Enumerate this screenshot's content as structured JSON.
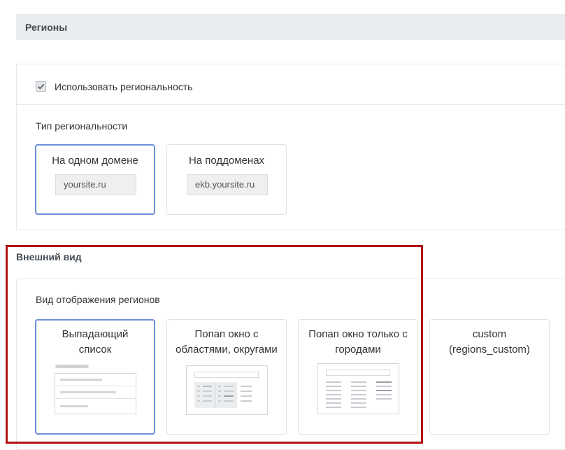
{
  "regions": {
    "header": "Регионы",
    "use_regionality": {
      "label": "Использовать региональность",
      "checked": true
    },
    "type": {
      "label": "Тип региональности",
      "options": [
        {
          "title": "На одном домене",
          "example": "yoursite.ru",
          "selected": true
        },
        {
          "title": "На поддоменах",
          "example": "ekb.yoursite.ru",
          "selected": false
        }
      ]
    }
  },
  "appearance": {
    "header": "Внешний вид",
    "display": {
      "label": "Вид отображения регионов",
      "options": [
        {
          "title_line1": "Выпадающий",
          "title_line2": "список",
          "icon": "dropdown-list-preview",
          "selected": true
        },
        {
          "title_line1": "Попап окно с",
          "title_line2": "областями, округами",
          "icon": "popup-regions-preview",
          "selected": false
        },
        {
          "title_line1": "Попап окно только с",
          "title_line2": "городами",
          "icon": "popup-cities-preview",
          "selected": false
        },
        {
          "title_line1": "custom",
          "title_line2": "(regions_custom)",
          "icon": "",
          "selected": false
        }
      ]
    }
  },
  "colors": {
    "selected_border": "#6d8ed8",
    "highlight_frame": "#b01313",
    "header_bg": "#e9edef"
  }
}
